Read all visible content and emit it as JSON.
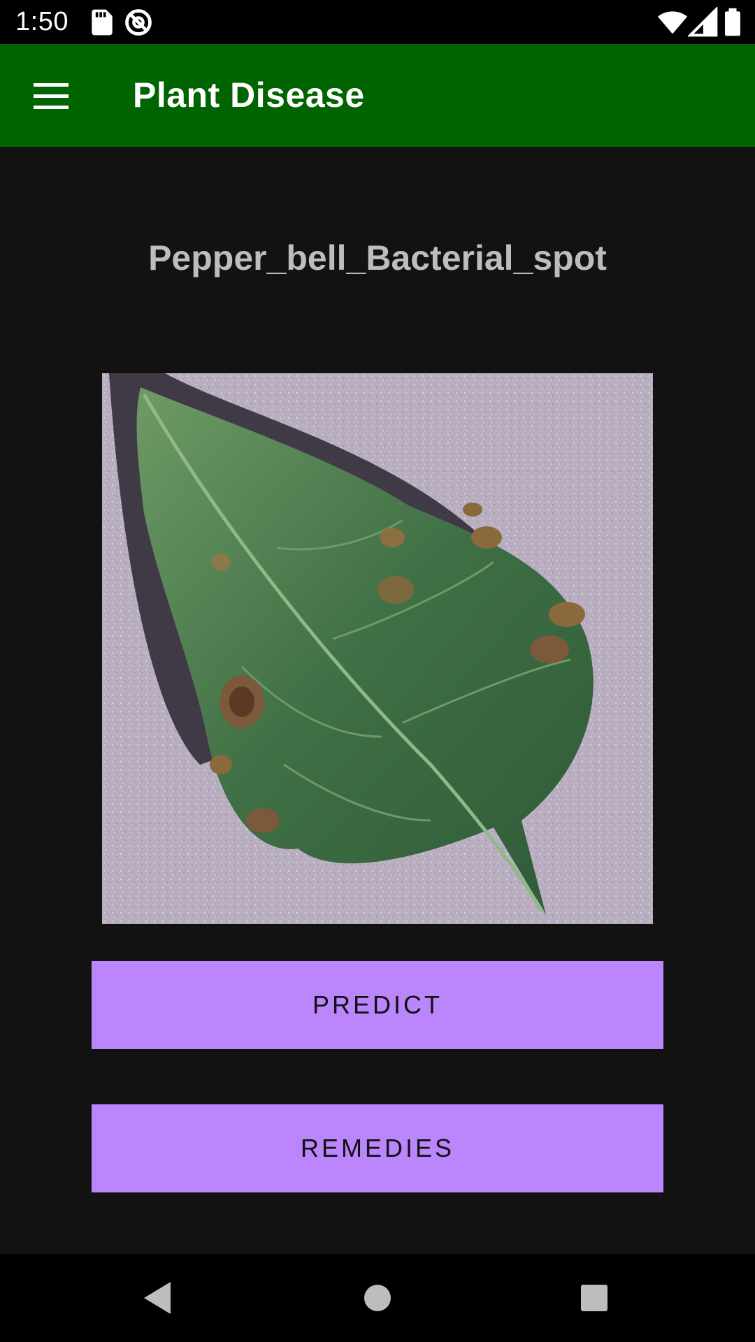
{
  "status_bar": {
    "time": "1:50",
    "icons": [
      "sd-card-icon",
      "at-sign-icon",
      "wifi-icon",
      "signal-icon",
      "battery-icon"
    ]
  },
  "app_bar": {
    "title": "Plant Disease",
    "menu_icon": "hamburger-menu-icon",
    "background_color": "#006400"
  },
  "main": {
    "prediction_label": "Pepper_bell_Bacterial_spot",
    "image": "pepper-leaf-image",
    "predict_button": "PREDICT",
    "remedies_button": "REMEDIES",
    "button_color": "#bb86fc"
  },
  "nav_bar": {
    "buttons": [
      "back-icon",
      "home-icon",
      "recents-icon"
    ]
  }
}
